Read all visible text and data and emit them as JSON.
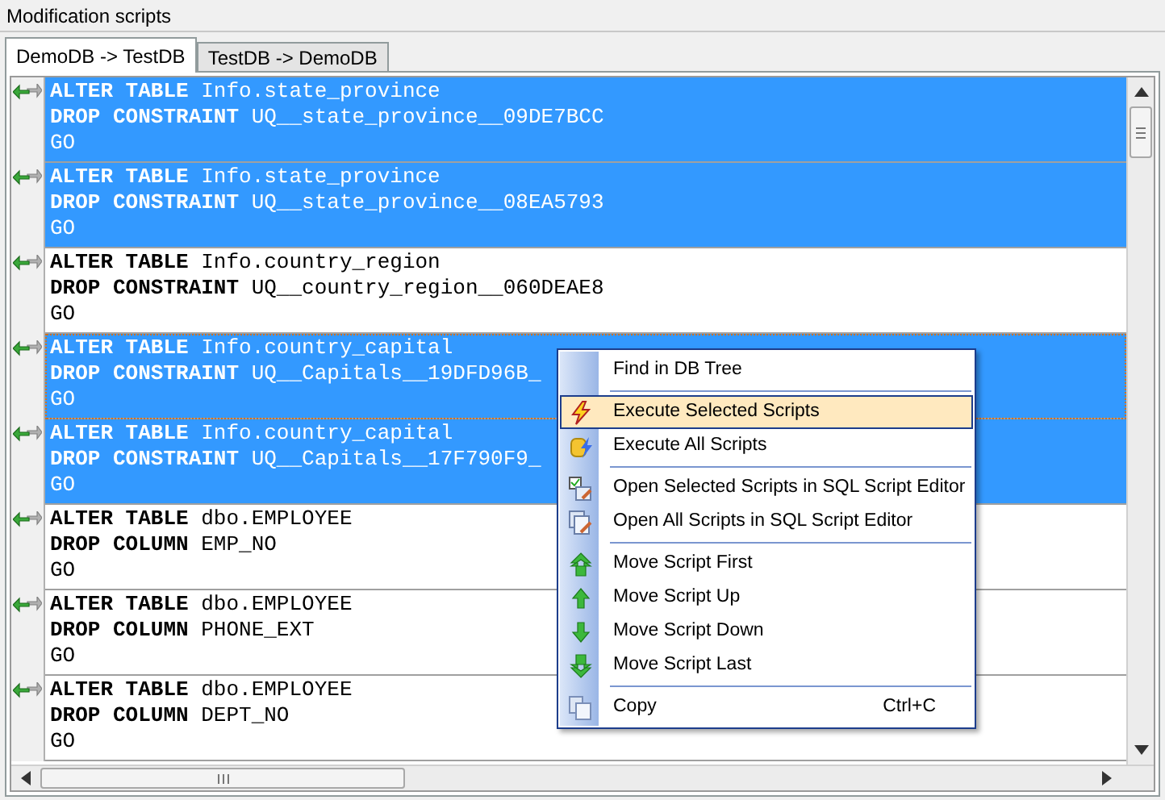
{
  "panel": {
    "title": "Modification scripts"
  },
  "tabs": [
    {
      "label": "DemoDB -> TestDB",
      "selected": true
    },
    {
      "label": "TestDB -> DemoDB",
      "selected": false
    }
  ],
  "scripts": [
    {
      "selected": true,
      "focused": false,
      "lines": [
        "**ALTER TABLE** Info.state_province",
        "**DROP CONSTRAINT** UQ__state_province__09DE7BCC",
        "GO"
      ]
    },
    {
      "selected": true,
      "focused": false,
      "lines": [
        "**ALTER TABLE** Info.state_province",
        "**DROP CONSTRAINT** UQ__state_province__08EA5793",
        "GO"
      ]
    },
    {
      "selected": false,
      "focused": false,
      "lines": [
        "**ALTER TABLE** Info.country_region",
        "**DROP CONSTRAINT** UQ__country_region__060DEAE8",
        "GO"
      ]
    },
    {
      "selected": true,
      "focused": true,
      "lines": [
        "**ALTER TABLE** Info.country_capital",
        "**DROP CONSTRAINT** UQ__Capitals__19DFD96B_",
        "GO"
      ]
    },
    {
      "selected": true,
      "focused": false,
      "lines": [
        "**ALTER TABLE** Info.country_capital",
        "**DROP CONSTRAINT** UQ__Capitals__17F790F9_",
        "GO"
      ]
    },
    {
      "selected": false,
      "focused": false,
      "lines": [
        "**ALTER TABLE** dbo.EMPLOYEE",
        "**DROP COLUMN** EMP_NO",
        "GO"
      ]
    },
    {
      "selected": false,
      "focused": false,
      "lines": [
        "**ALTER TABLE** dbo.EMPLOYEE",
        "**DROP COLUMN** PHONE_EXT",
        "GO"
      ]
    },
    {
      "selected": false,
      "focused": false,
      "lines": [
        "**ALTER TABLE** dbo.EMPLOYEE",
        "**DROP COLUMN** DEPT_NO",
        "GO"
      ]
    }
  ],
  "context_menu": {
    "groups": [
      {
        "items": [
          {
            "label": "Find in DB Tree",
            "selected": false
          }
        ]
      },
      {
        "items": [
          {
            "label": "Execute Selected Scripts",
            "selected": true
          },
          {
            "label": "Execute All Scripts",
            "selected": false
          }
        ]
      },
      {
        "items": [
          {
            "label": "Open Selected Scripts in SQL Script Editor",
            "selected": false
          },
          {
            "label": "Open All Scripts in SQL Script Editor",
            "selected": false
          }
        ]
      },
      {
        "items": [
          {
            "label": "Move Script First",
            "selected": false
          },
          {
            "label": "Move Script Up",
            "selected": false
          },
          {
            "label": "Move Script Down",
            "selected": false
          },
          {
            "label": "Move Script Last",
            "selected": false
          }
        ]
      },
      {
        "items": [
          {
            "label": "Copy",
            "shortcut": "Ctrl+C",
            "selected": false
          }
        ]
      }
    ]
  }
}
